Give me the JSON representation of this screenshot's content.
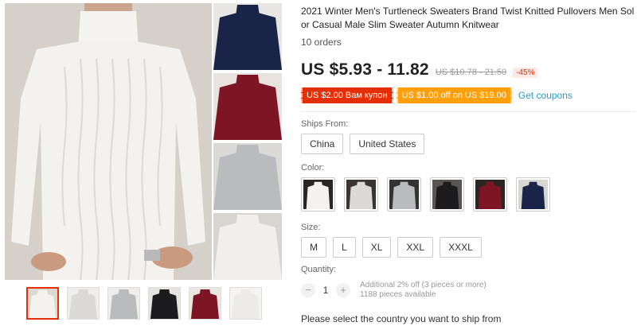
{
  "product": {
    "title_line1": "2021 Winter Men's Turtleneck Sweaters Brand Twist Knitted Pullovers Men Solid Col",
    "title_line2": "or Casual Male Slim Sweater Autumn Knitwear",
    "orders": "10 orders"
  },
  "pricing": {
    "price": "US $5.93 - 11.82",
    "old_price": "US $10.78 - 21.50",
    "discount": "-45%"
  },
  "coupons": {
    "store_coupon": "US $2.00 Вам купон",
    "select_coupon": "US $1.00 off on US $19.00",
    "get_coupons": "Get coupons"
  },
  "ships_from": {
    "label": "Ships From:",
    "options": [
      "China",
      "United States"
    ]
  },
  "color": {
    "label": "Color:",
    "swatches": [
      {
        "name": "white",
        "hex": "#f4f2ef"
      },
      {
        "name": "light gray",
        "hex": "#dcdad8"
      },
      {
        "name": "gray",
        "hex": "#b9bbbf"
      },
      {
        "name": "black",
        "hex": "#1c1c1e"
      },
      {
        "name": "burgundy",
        "hex": "#7d1524"
      },
      {
        "name": "navy",
        "hex": "#1a2448"
      }
    ]
  },
  "size": {
    "label": "Size:",
    "options": [
      "M",
      "L",
      "XL",
      "XXL",
      "XXXL"
    ]
  },
  "quantity": {
    "label": "Quantity:",
    "value": "1",
    "minus": "−",
    "plus": "+",
    "discount_note": "Additional 2% off (3 pieces or more)",
    "available": "1188 pieces available"
  },
  "shipping_note": "Please select the country you want to ship from",
  "gallery": {
    "main_color": "#f4f2ef",
    "side_colors": [
      "#1a2448",
      "#7d1524",
      "#b9bbbf",
      "#ecebe8"
    ],
    "thumb_colors": [
      "#f4f2ef",
      "#dcdad8",
      "#b9bbbf",
      "#1c1c1e",
      "#7d1524",
      "#ecebe8"
    ]
  }
}
